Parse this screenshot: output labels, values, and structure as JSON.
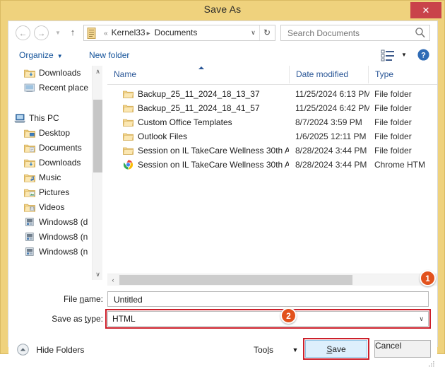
{
  "window": {
    "title": "Save As",
    "close_label": "✕",
    "close_icon": "close-icon"
  },
  "navbar": {
    "back_glyph": "←",
    "forward_glyph": "→",
    "recent_glyph": "▼",
    "up_glyph": "↑",
    "address": {
      "icon": "folder-documents-icon",
      "prefix": "«",
      "crumbs": [
        "Kernel33",
        "Documents"
      ],
      "separator": "▸",
      "dropdown_glyph": "∨",
      "refresh_glyph": "↻"
    },
    "search": {
      "placeholder": "Search Documents",
      "value": "",
      "icon": "search-icon"
    }
  },
  "toolbar": {
    "organize_label": "Organize",
    "organize_caret": "▼",
    "new_folder_label": "New folder",
    "view_icon": "view-layout-icon",
    "view_caret": "▼",
    "help_icon": "help-icon"
  },
  "sidebar": {
    "items": [
      {
        "label": "Downloads",
        "icon": "folder-downloads-icon",
        "depth": 1
      },
      {
        "label": "Recent place",
        "icon": "recent-places-icon",
        "depth": 1
      },
      {
        "label": "",
        "icon": "spacer",
        "depth": 0
      },
      {
        "label": "This PC",
        "icon": "this-pc-icon",
        "depth": 0
      },
      {
        "label": "Desktop",
        "icon": "folder-desktop-icon",
        "depth": 1
      },
      {
        "label": "Documents",
        "icon": "folder-documents-icon",
        "depth": 1
      },
      {
        "label": "Downloads",
        "icon": "folder-downloads-icon",
        "depth": 1
      },
      {
        "label": "Music",
        "icon": "folder-music-icon",
        "depth": 1
      },
      {
        "label": "Pictures",
        "icon": "folder-pictures-icon",
        "depth": 1
      },
      {
        "label": "Videos",
        "icon": "folder-videos-icon",
        "depth": 1
      },
      {
        "label": "Windows8 (d",
        "icon": "drive-icon",
        "depth": 1
      },
      {
        "label": "Windows8 (n",
        "icon": "drive-icon",
        "depth": 1
      },
      {
        "label": "Windows8 (n",
        "icon": "drive-icon",
        "depth": 1
      }
    ],
    "scroll_up_glyph": "∧",
    "scroll_down_glyph": "∨"
  },
  "filelist": {
    "columns": [
      "Name",
      "Date modified",
      "Type"
    ],
    "sort_column": "Name",
    "sort_direction": "ascending",
    "rows": [
      {
        "name": "Backup_25_11_2024_18_13_37",
        "date": "11/25/2024 6:13 PM",
        "type": "File folder",
        "icon": "folder-icon"
      },
      {
        "name": "Backup_25_11_2024_18_41_57",
        "date": "11/25/2024 6:42 PM",
        "type": "File folder",
        "icon": "folder-icon"
      },
      {
        "name": "Custom Office Templates",
        "date": "8/7/2024 3:59 PM",
        "type": "File folder",
        "icon": "folder-icon"
      },
      {
        "name": "Outlook Files",
        "date": "1/6/2025 12:11 PM",
        "type": "File folder",
        "icon": "folder-icon"
      },
      {
        "name": "Session on IL TakeCare  Wellness  30th A...",
        "date": "8/28/2024 3:44 PM",
        "type": "File folder",
        "icon": "folder-icon"
      },
      {
        "name": "Session on IL TakeCare  Wellness  30th A...",
        "date": "8/28/2024 3:44 PM",
        "type": "Chrome HTM",
        "icon": "chrome-icon"
      }
    ],
    "hscroll_left_glyph": "‹",
    "hscroll_right_glyph": "›"
  },
  "form": {
    "filename_label_pre": "File ",
    "filename_label_accel": "n",
    "filename_label_post": "ame:",
    "filename_value": "Untitled",
    "filename_placeholder": "",
    "savetype_label_pre": "Save as ",
    "savetype_label_accel": "t",
    "savetype_label_post": "ype:",
    "savetype_value": "HTML",
    "savetype_caret": "∨"
  },
  "footer": {
    "hide_folders_label": "Hide Folders",
    "hide_folders_icon": "collapse-up-icon",
    "tools_label_pre": "Too",
    "tools_label_accel": "l",
    "tools_label_post": "s",
    "tools_caret": "▼",
    "save_label_pre": "",
    "save_label_accel": "S",
    "save_label_post": "ave",
    "cancel_label": "Cancel"
  },
  "annotations": {
    "badge_1": "1",
    "badge_2": "2",
    "highlight_color": "#cc1f2a",
    "badge_color": "#e2521d"
  },
  "colors": {
    "titlebar": "#efd27d",
    "close_button": "#c9434a",
    "link_text": "#14539a",
    "column_header_text": "#2b5797",
    "save_button_fill": "#ddeffc"
  }
}
